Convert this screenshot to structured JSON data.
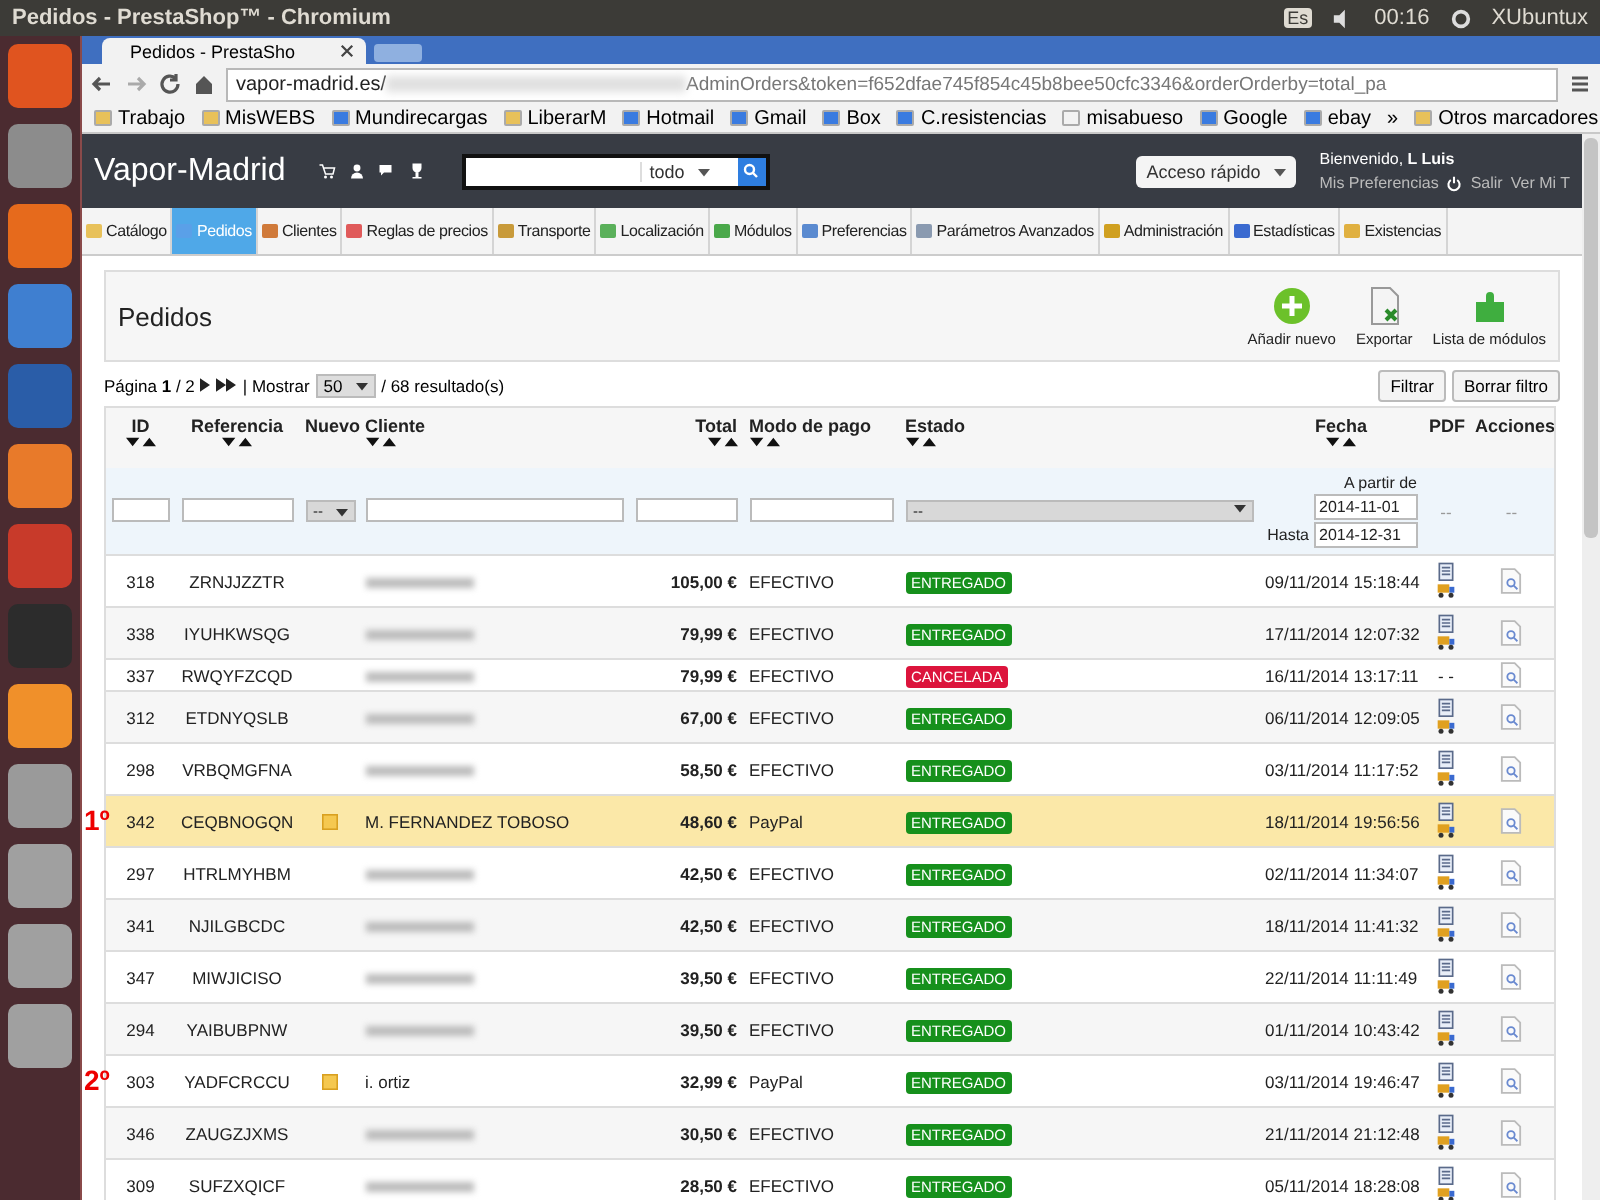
{
  "os_bar": {
    "title": "Pedidos - PrestaShop™ - Chromium",
    "keyboard": "Es",
    "time": "00:16",
    "user": "XUbuntux"
  },
  "browser": {
    "tab": "Pedidos - PrestaSho",
    "url_host": "vapor-madrid.es/",
    "url_rest": "AdminOrders&token=f652dfae745f854c45b8bee50cfc3346&orderOrderby=total_pa",
    "bookmarks": [
      {
        "label": "Trabajo",
        "kind": "folder"
      },
      {
        "label": "MisWEBS",
        "kind": "folder"
      },
      {
        "label": "Mundirecargas",
        "kind": "site"
      },
      {
        "label": "LiberarM",
        "kind": "folder"
      },
      {
        "label": "Hotmail",
        "kind": "site"
      },
      {
        "label": "Gmail",
        "kind": "site"
      },
      {
        "label": "Box",
        "kind": "site"
      },
      {
        "label": "C.resistencias",
        "kind": "site"
      },
      {
        "label": "misabueso",
        "kind": "page"
      },
      {
        "label": "Google",
        "kind": "site"
      },
      {
        "label": "ebay",
        "kind": "site"
      }
    ],
    "more": "»",
    "other_bookmarks": "Otros marcadores"
  },
  "header": {
    "shop": "Vapor-Madrid",
    "search_scope": "todo",
    "quick_access": "Acceso rápido",
    "welcome": "Bienvenido, ",
    "user": "L Luis",
    "preferences": "Mis Preferencias",
    "logout": "Salir",
    "view": "Ver Mi T"
  },
  "nav": [
    {
      "label": "Catálogo",
      "selected": false
    },
    {
      "label": "Pedidos",
      "selected": true
    },
    {
      "label": "Clientes",
      "selected": false
    },
    {
      "label": "Reglas de precios",
      "selected": false
    },
    {
      "label": "Transporte",
      "selected": false
    },
    {
      "label": "Localización",
      "selected": false
    },
    {
      "label": "Módulos",
      "selected": false
    },
    {
      "label": "Preferencias",
      "selected": false
    },
    {
      "label": "Parámetros Avanzados",
      "selected": false
    },
    {
      "label": "Administración",
      "selected": false
    },
    {
      "label": "Estadísticas",
      "selected": false
    },
    {
      "label": "Existencias",
      "selected": false
    }
  ],
  "page": {
    "title": "Pedidos",
    "actions": [
      {
        "label": "Añadir nuevo",
        "kind": "add"
      },
      {
        "label": "Exportar",
        "kind": "export"
      },
      {
        "label": "Lista de módulos",
        "kind": "modules"
      }
    ]
  },
  "pagination": {
    "page_label": "Página ",
    "page": "1",
    "of": " / 2",
    "show": "| Mostrar",
    "per_page": "50",
    "results": "/ 68 resultado(s)",
    "filter": "Filtrar",
    "reset": "Borrar filtro"
  },
  "table": {
    "columns": [
      {
        "label": "ID",
        "sort": true
      },
      {
        "label": "Referencia",
        "sort": true
      },
      {
        "label": "Nuevo",
        "sort": false
      },
      {
        "label": "Cliente",
        "sort": true
      },
      {
        "label": "Total",
        "sort": true
      },
      {
        "label": "Modo de pago",
        "sort": true
      },
      {
        "label": "Estado",
        "sort": true
      },
      {
        "label": "Fecha",
        "sort": true
      },
      {
        "label": "PDF",
        "sort": false
      },
      {
        "label": "Acciones",
        "sort": false
      }
    ],
    "filters": {
      "new": "--",
      "status": "--",
      "from_label": "A partir de",
      "from": "2014-11-01",
      "to_label": "Hasta",
      "to": "2014-12-31",
      "pdf": "--",
      "actions": "--"
    },
    "rows": [
      {
        "id": "318",
        "ref": "ZRNJJZZTR",
        "new": false,
        "client_hidden": true,
        "total": "105,00 €",
        "payment": "EFECTIVO",
        "status": {
          "label": "ENTREGADO",
          "color": "#16901c"
        },
        "date": "09/11/2014 15:18:44",
        "selected": false
      },
      {
        "id": "338",
        "ref": "IYUHKWSQG",
        "new": false,
        "client_hidden": true,
        "total": "79,99 €",
        "payment": "EFECTIVO",
        "status": {
          "label": "ENTREGADO",
          "color": "#16901c"
        },
        "date": "17/11/2014 12:07:32",
        "selected": false
      },
      {
        "id": "337",
        "ref": "RWQYFZCQD",
        "new": false,
        "client_hidden": true,
        "total": "79,99 €",
        "payment": "EFECTIVO",
        "status": {
          "label": "CANCELADA",
          "color": "#dc143c"
        },
        "date": "16/11/2014 13:17:11",
        "pdf_text": "- -",
        "selected": false
      },
      {
        "id": "312",
        "ref": "ETDNYQSLB",
        "new": false,
        "client_hidden": true,
        "total": "67,00 €",
        "payment": "EFECTIVO",
        "status": {
          "label": "ENTREGADO",
          "color": "#16901c"
        },
        "date": "06/11/2014 12:09:05",
        "selected": false
      },
      {
        "id": "298",
        "ref": "VRBQMGFNA",
        "new": false,
        "client_hidden": true,
        "total": "58,50 €",
        "payment": "EFECTIVO",
        "status": {
          "label": "ENTREGADO",
          "color": "#16901c"
        },
        "date": "03/11/2014 11:17:52",
        "selected": false
      },
      {
        "id": "342",
        "ref": "CEQBNOGQN",
        "new": true,
        "client": "M. FERNANDEZ TOBOSO",
        "total": "48,60 €",
        "payment": "PayPal",
        "status": {
          "label": "ENTREGADO",
          "color": "#16901c"
        },
        "date": "18/11/2014 19:56:56",
        "selected": true,
        "annotation": "1º"
      },
      {
        "id": "297",
        "ref": "HTRLMYHBM",
        "new": false,
        "client_hidden": true,
        "total": "42,50 €",
        "payment": "EFECTIVO",
        "status": {
          "label": "ENTREGADO",
          "color": "#16901c"
        },
        "date": "02/11/2014 11:34:07",
        "selected": false
      },
      {
        "id": "341",
        "ref": "NJILGBCDC",
        "new": false,
        "client_hidden": true,
        "total": "42,50 €",
        "payment": "EFECTIVO",
        "status": {
          "label": "ENTREGADO",
          "color": "#16901c"
        },
        "date": "18/11/2014 11:41:32",
        "selected": false
      },
      {
        "id": "347",
        "ref": "MIWJICISO",
        "new": false,
        "client_hidden": true,
        "total": "39,50 €",
        "payment": "EFECTIVO",
        "status": {
          "label": "ENTREGADO",
          "color": "#16901c"
        },
        "date": "22/11/2014 11:11:49",
        "selected": false
      },
      {
        "id": "294",
        "ref": "YAIBUBPNW",
        "new": false,
        "client_hidden": true,
        "total": "39,50 €",
        "payment": "EFECTIVO",
        "status": {
          "label": "ENTREGADO",
          "color": "#16901c"
        },
        "date": "01/11/2014 10:43:42",
        "selected": false
      },
      {
        "id": "303",
        "ref": "YADFCRCCU",
        "new": true,
        "client": "i. ortiz",
        "total": "32,99 €",
        "payment": "PayPal",
        "status": {
          "label": "ENTREGADO",
          "color": "#16901c"
        },
        "date": "03/11/2014 19:46:47",
        "selected": false,
        "annotation": "2º"
      },
      {
        "id": "346",
        "ref": "ZAUGZJXMS",
        "new": false,
        "client_hidden": true,
        "total": "30,50 €",
        "payment": "EFECTIVO",
        "status": {
          "label": "ENTREGADO",
          "color": "#16901c"
        },
        "date": "21/11/2014 21:12:48",
        "selected": false
      },
      {
        "id": "309",
        "ref": "SUFZXQICF",
        "new": false,
        "client_hidden": true,
        "total": "28,50 €",
        "payment": "EFECTIVO",
        "status": {
          "label": "ENTREGADO",
          "color": "#16901c"
        },
        "date": "05/11/2014 18:28:08",
        "selected": false
      }
    ]
  }
}
